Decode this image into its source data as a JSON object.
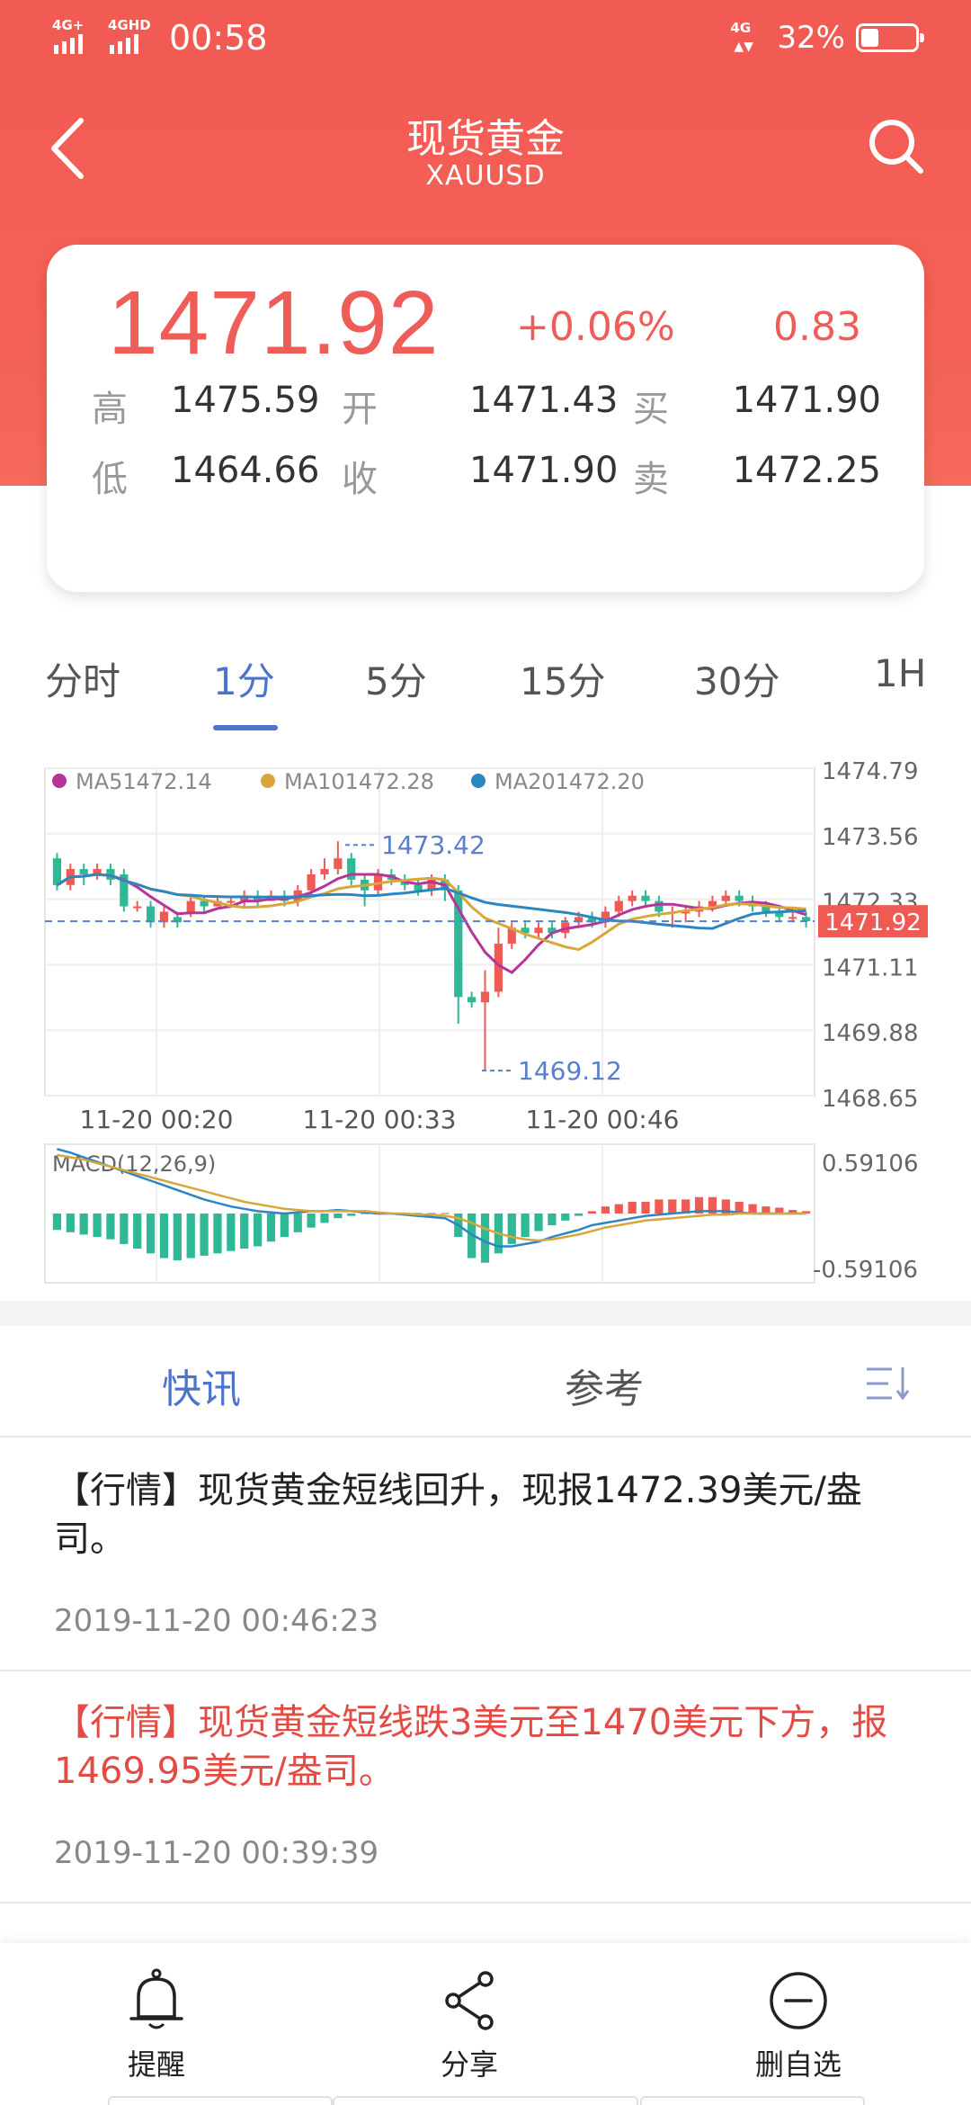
{
  "status_bar": {
    "signal1_tag": "4G+",
    "signal2_tag": "4GHD",
    "time": "00:58",
    "network_tag": "4G",
    "battery": "32%",
    "battery_level": 0.32
  },
  "header": {
    "title": "现货黄金",
    "subtitle": "XAUUSD",
    "back_icon": "chevron-left-icon",
    "search_icon": "search-icon"
  },
  "quote": {
    "price": "1471.92",
    "change_pct": "+0.06%",
    "change": "0.83",
    "rows": [
      {
        "l1": "高",
        "v1": "1475.59",
        "l2": "开",
        "v2": "1471.43",
        "l3": "买",
        "v3": "1471.90"
      },
      {
        "l1": "低",
        "v1": "1464.66",
        "l2": "收",
        "v2": "1471.90",
        "l3": "卖",
        "v3": "1472.25"
      }
    ],
    "accent_color": "#ee5d57"
  },
  "periods": {
    "tabs": [
      "分时",
      "1分",
      "5分",
      "15分",
      "30分",
      "1H"
    ],
    "active_index": 1
  },
  "chart_data": {
    "type": "candlestick",
    "legend": [
      {
        "name": "MA5",
        "value": "1472.14",
        "color": "#b5359b"
      },
      {
        "name": "MA10",
        "value": "1472.28",
        "color": "#d8a63a"
      },
      {
        "name": "MA20",
        "value": "1472.20",
        "color": "#2c86c0"
      }
    ],
    "y_ticks": [
      "1474.79",
      "1473.56",
      "1472.33",
      "1471.11",
      "1469.88",
      "1468.65"
    ],
    "ylim": [
      1468.65,
      1474.79
    ],
    "x_ticks": [
      "11-20 00:20",
      "11-20 00:33",
      "11-20 00:46"
    ],
    "current_price": "1471.92",
    "current_price_value": 1471.92,
    "max_label": "1473.42",
    "min_label": "1469.12",
    "up_color": "#ef5a55",
    "down_color": "#2fb896",
    "candles": [
      [
        1473.1,
        1472.6,
        1473.2,
        1472.5
      ],
      [
        1472.6,
        1472.9,
        1473.0,
        1472.5
      ],
      [
        1472.9,
        1472.8,
        1473.0,
        1472.6
      ],
      [
        1472.8,
        1472.9,
        1473.0,
        1472.7
      ],
      [
        1472.9,
        1472.7,
        1473.0,
        1472.6
      ],
      [
        1472.8,
        1472.2,
        1472.9,
        1472.1
      ],
      [
        1472.2,
        1472.2,
        1472.3,
        1472.1
      ],
      [
        1472.2,
        1471.9,
        1472.3,
        1471.8
      ],
      [
        1471.9,
        1472.1,
        1472.2,
        1471.8
      ],
      [
        1472.0,
        1471.9,
        1472.1,
        1471.8
      ],
      [
        1472.1,
        1472.3,
        1472.4,
        1472.0
      ],
      [
        1472.3,
        1472.2,
        1472.4,
        1472.1
      ],
      [
        1472.2,
        1472.3,
        1472.4,
        1472.2
      ],
      [
        1472.3,
        1472.3,
        1472.4,
        1472.2
      ],
      [
        1472.3,
        1472.4,
        1472.5,
        1472.2
      ],
      [
        1472.4,
        1472.3,
        1472.5,
        1472.2
      ],
      [
        1472.3,
        1472.4,
        1472.5,
        1472.3
      ],
      [
        1472.4,
        1472.3,
        1472.5,
        1472.2
      ],
      [
        1472.3,
        1472.5,
        1472.6,
        1472.2
      ],
      [
        1472.5,
        1472.8,
        1472.9,
        1472.4
      ],
      [
        1472.8,
        1472.9,
        1473.1,
        1472.7
      ],
      [
        1472.9,
        1473.1,
        1473.42,
        1472.8
      ],
      [
        1473.1,
        1472.7,
        1473.2,
        1472.6
      ],
      [
        1472.7,
        1472.5,
        1472.8,
        1472.2
      ],
      [
        1472.5,
        1472.8,
        1472.9,
        1472.4
      ],
      [
        1472.8,
        1472.7,
        1472.9,
        1472.6
      ],
      [
        1472.7,
        1472.6,
        1472.8,
        1472.5
      ],
      [
        1472.6,
        1472.5,
        1472.7,
        1472.4
      ],
      [
        1472.5,
        1472.7,
        1472.8,
        1472.4
      ],
      [
        1472.7,
        1472.5,
        1472.8,
        1472.3
      ],
      [
        1472.5,
        1470.5,
        1472.6,
        1470.0
      ],
      [
        1470.5,
        1470.4,
        1470.6,
        1470.3
      ],
      [
        1470.4,
        1470.6,
        1471.0,
        1469.12
      ],
      [
        1470.6,
        1471.5,
        1471.8,
        1470.5
      ],
      [
        1471.5,
        1471.8,
        1471.9,
        1471.4
      ],
      [
        1471.8,
        1471.7,
        1471.9,
        1471.6
      ],
      [
        1471.7,
        1471.8,
        1471.9,
        1471.6
      ],
      [
        1471.8,
        1471.7,
        1471.9,
        1471.6
      ],
      [
        1471.7,
        1471.9,
        1472.0,
        1471.6
      ],
      [
        1471.9,
        1472.0,
        1472.1,
        1471.8
      ],
      [
        1472.0,
        1471.9,
        1472.1,
        1471.8
      ],
      [
        1471.9,
        1472.1,
        1472.2,
        1471.8
      ],
      [
        1472.1,
        1472.3,
        1472.4,
        1472.0
      ],
      [
        1472.3,
        1472.4,
        1472.5,
        1472.2
      ],
      [
        1472.4,
        1472.3,
        1472.5,
        1472.2
      ],
      [
        1472.3,
        1472.1,
        1472.4,
        1472.0
      ],
      [
        1472.1,
        1472.1,
        1472.2,
        1471.8
      ],
      [
        1472.1,
        1472.1,
        1472.2,
        1471.9
      ],
      [
        1472.1,
        1472.2,
        1472.3,
        1472.0
      ],
      [
        1472.2,
        1472.3,
        1472.4,
        1472.1
      ],
      [
        1472.3,
        1472.4,
        1472.5,
        1472.2
      ],
      [
        1472.4,
        1472.3,
        1472.5,
        1472.2
      ],
      [
        1472.3,
        1472.2,
        1472.4,
        1472.1
      ],
      [
        1472.2,
        1472.1,
        1472.3,
        1472.0
      ],
      [
        1472.1,
        1472.0,
        1472.2,
        1471.9
      ],
      [
        1472.0,
        1472.0,
        1472.1,
        1471.9
      ],
      [
        1472.0,
        1471.92,
        1472.1,
        1471.8
      ]
    ],
    "macd": {
      "label": "MACD(12,26,9)",
      "y_ticks": [
        "0.59106",
        "-0.59106"
      ],
      "ylim": [
        -0.59106,
        0.59106
      ],
      "hist": [
        -0.14,
        -0.16,
        -0.18,
        -0.2,
        -0.22,
        -0.26,
        -0.3,
        -0.34,
        -0.38,
        -0.4,
        -0.38,
        -0.36,
        -0.34,
        -0.32,
        -0.3,
        -0.28,
        -0.24,
        -0.2,
        -0.16,
        -0.12,
        -0.08,
        -0.04,
        -0.02,
        0.0,
        0.0,
        0.0,
        0.0,
        0.0,
        0.0,
        0.0,
        -0.2,
        -0.38,
        -0.42,
        -0.34,
        -0.26,
        -0.2,
        -0.15,
        -0.1,
        -0.06,
        -0.02,
        0.02,
        0.06,
        0.08,
        0.1,
        0.1,
        0.12,
        0.12,
        0.12,
        0.14,
        0.14,
        0.12,
        0.1,
        0.08,
        0.06,
        0.05,
        0.03,
        0.02
      ],
      "dif": [
        0.55,
        0.52,
        0.48,
        0.44,
        0.4,
        0.36,
        0.32,
        0.28,
        0.24,
        0.2,
        0.16,
        0.12,
        0.09,
        0.06,
        0.04,
        0.02,
        0.01,
        0.0,
        0.01,
        0.02,
        0.02,
        0.03,
        0.02,
        0.01,
        0.0,
        0.0,
        -0.01,
        -0.02,
        -0.03,
        -0.04,
        -0.1,
        -0.18,
        -0.24,
        -0.28,
        -0.28,
        -0.26,
        -0.24,
        -0.2,
        -0.17,
        -0.14,
        -0.1,
        -0.08,
        -0.06,
        -0.04,
        -0.02,
        -0.01,
        0.0,
        0.01,
        0.02,
        0.02,
        0.02,
        0.01,
        0.0,
        0.0,
        0.0,
        0.0,
        0.0
      ],
      "dea": [
        0.5,
        0.48,
        0.46,
        0.43,
        0.4,
        0.37,
        0.34,
        0.31,
        0.28,
        0.25,
        0.22,
        0.19,
        0.16,
        0.13,
        0.1,
        0.08,
        0.06,
        0.04,
        0.03,
        0.02,
        0.02,
        0.02,
        0.02,
        0.02,
        0.01,
        0.0,
        0.0,
        -0.01,
        -0.01,
        -0.02,
        -0.04,
        -0.08,
        -0.13,
        -0.17,
        -0.2,
        -0.22,
        -0.23,
        -0.22,
        -0.2,
        -0.18,
        -0.15,
        -0.12,
        -0.1,
        -0.08,
        -0.06,
        -0.05,
        -0.04,
        -0.03,
        -0.02,
        -0.01,
        -0.01,
        0.0,
        0.0,
        0.0,
        0.0,
        0.0,
        0.0
      ],
      "dif_color": "#2c86c0",
      "dea_color": "#d8a63a"
    }
  },
  "news_tabs": {
    "tabs": [
      "快讯",
      "参考"
    ],
    "active_index": 0,
    "menu_icon": "list-sort-icon"
  },
  "news": [
    {
      "text": "【行情】现货黄金短线回升，现报1472.39美元/盎司。",
      "time": "2019-11-20 00:46:23",
      "highlight": false
    },
    {
      "text": "【行情】现货黄金短线跌3美元至1470美元下方，报1469.95美元/盎司。",
      "time": "2019-11-20 00:39:39",
      "highlight": true
    }
  ],
  "bottom_bar": {
    "items": [
      {
        "label": "提醒",
        "icon": "bell-icon"
      },
      {
        "label": "分享",
        "icon": "share-icon"
      },
      {
        "label": "删自选",
        "icon": "remove-circle-icon"
      }
    ]
  }
}
